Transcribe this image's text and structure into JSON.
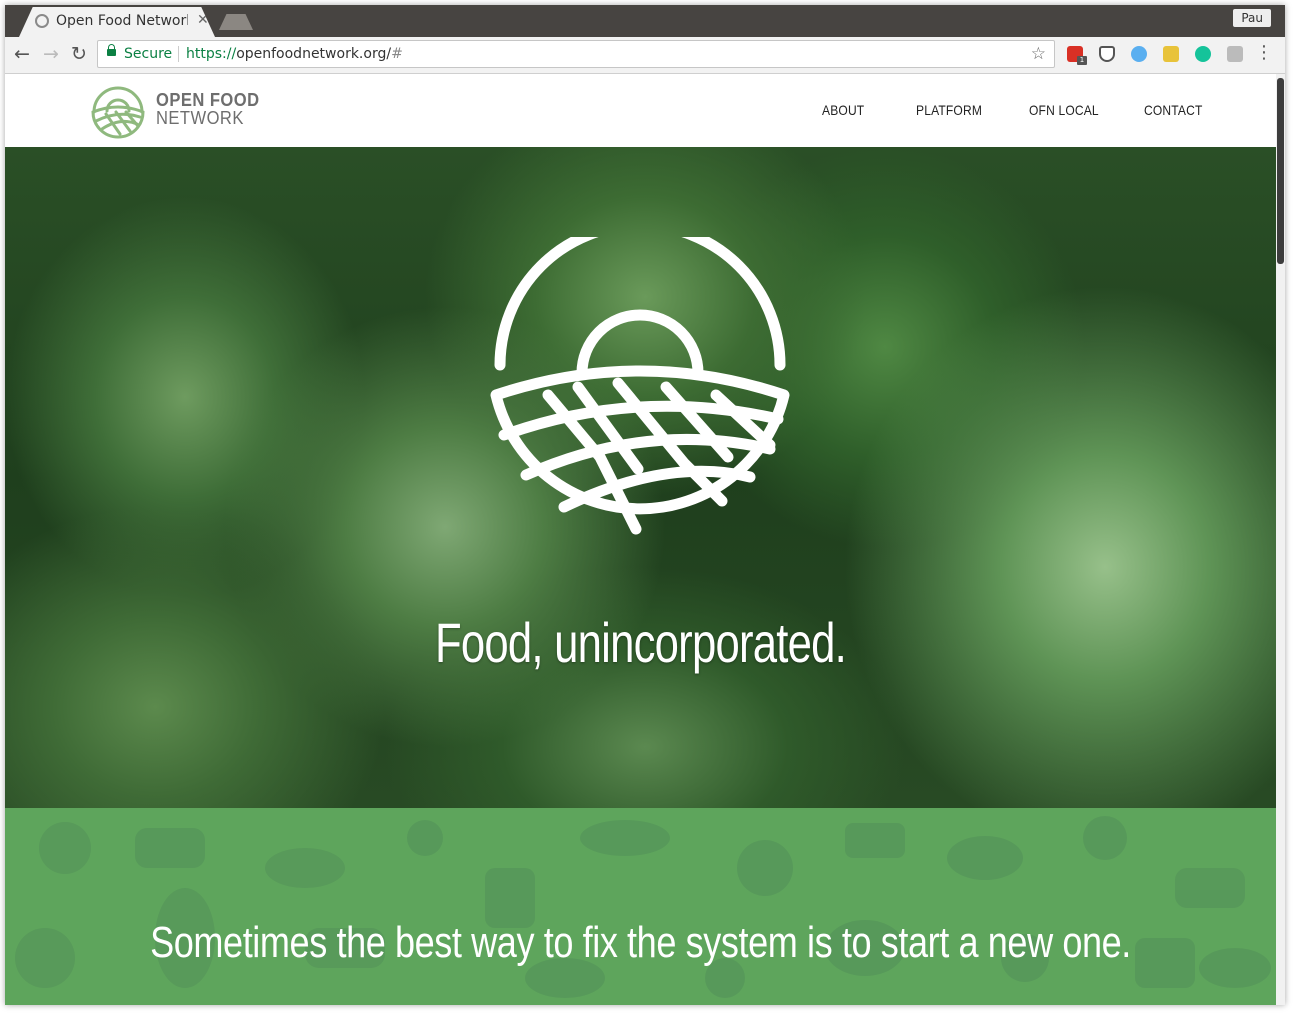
{
  "browser": {
    "tab_title": "Open Food Network",
    "profile_label": "Pau",
    "secure_label": "Secure",
    "url_scheme": "https://",
    "url_host": "openfoodnetwork.org/",
    "url_hash": "#",
    "extension_badge": "1"
  },
  "site": {
    "logo_line1": "OPEN FOOD",
    "logo_line2": "NETWORK",
    "nav": [
      "ABOUT",
      "PLATFORM",
      "OFN LOCAL",
      "CONTACT"
    ],
    "hero_title": "Food, unincorporated.",
    "tagline": "Sometimes the best way to fix the system is to start a new one."
  },
  "colors": {
    "brand_green": "#5ea55c",
    "logo_green": "#8fb97e",
    "chrome_dark": "#474441",
    "secure_green": "#0b8043"
  }
}
